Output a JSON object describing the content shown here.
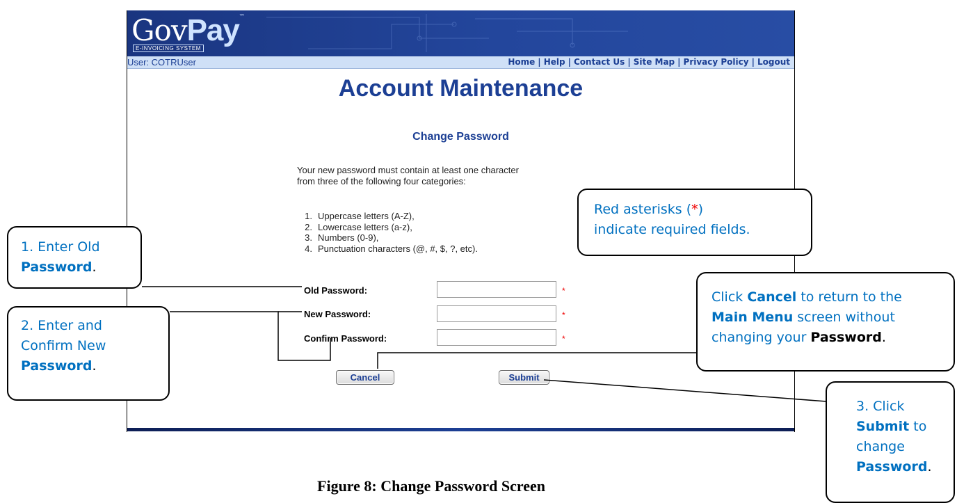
{
  "app": {
    "logo": {
      "gov": "Gov",
      "pay": "Pay",
      "tm": "™",
      "subtitle": "E-INVOICING SYSTEM"
    },
    "user_label": "User: COTRUser",
    "nav": [
      "Home",
      "Help",
      "Contact Us",
      "Site Map",
      "Privacy Policy",
      "Logout"
    ],
    "page_title": "Account Maintenance",
    "section_title": "Change Password",
    "intro_line1": "Your new password must contain at least one character",
    "intro_line2": "from three of the following four categories:",
    "rules": [
      {
        "num": "1.",
        "text": "Uppercase letters (A-Z),"
      },
      {
        "num": "2.",
        "text": "Lowercase letters (a-z),"
      },
      {
        "num": "3.",
        "text": "Numbers (0-9),"
      },
      {
        "num": "4.",
        "text": "Punctuation characters (@, #, $, ?, etc)."
      }
    ],
    "fields": {
      "old_label": "Old Password:",
      "new_label": "New Password:",
      "confirm_label": "Confirm Password:",
      "old_value": "",
      "new_value": "",
      "confirm_value": "",
      "required_marker": "*"
    },
    "buttons": {
      "cancel": "Cancel",
      "submit": "Submit"
    }
  },
  "callouts": {
    "old": {
      "line1": "1. Enter Old",
      "bold": "Password",
      "end": "."
    },
    "new": {
      "line1": "2. Enter and",
      "line2": "Confirm New",
      "bold": "Password",
      "end": "."
    },
    "required": {
      "pre": "Red asterisks (",
      "star": "*",
      "post": ")",
      "line2": "indicate required fields."
    },
    "cancel": {
      "t1": "Click ",
      "b1": "Cancel",
      "t2": " to return to the",
      "b2": "Main Menu",
      "t3": " screen without",
      "t4": "changing your ",
      "b3": "Password",
      "t5": "."
    },
    "submit": {
      "t1": "3. Click",
      "b1": "Submit",
      "t2": " to",
      "t3": "change",
      "b2": "Password",
      "t4": "."
    }
  },
  "caption": "Figure 8:  Change Password Screen"
}
